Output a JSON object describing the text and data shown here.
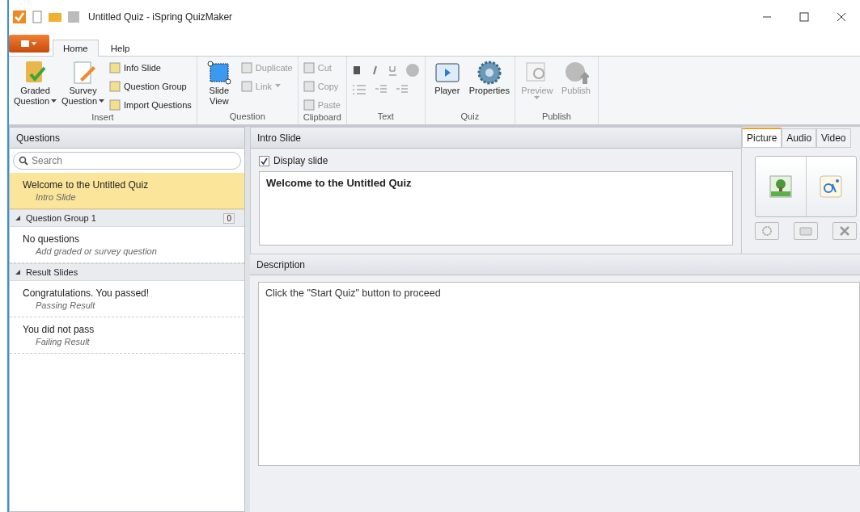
{
  "window": {
    "title": "Untitled Quiz - iSpring QuizMaker"
  },
  "ribbon": {
    "tabs": [
      {
        "label": "Home",
        "selected": true
      },
      {
        "label": "Help",
        "selected": false
      }
    ],
    "groups": [
      {
        "label": "Insert",
        "items": [
          {
            "kind": "large",
            "label": "Graded",
            "label2": "Question",
            "dropdown": true,
            "disabled": false
          },
          {
            "kind": "large",
            "label": "Survey",
            "label2": "Question",
            "dropdown": true,
            "disabled": false
          },
          {
            "kind": "small",
            "label": "Info Slide",
            "disabled": false
          },
          {
            "kind": "small",
            "label": "Question Group",
            "disabled": false
          },
          {
            "kind": "small",
            "label": "Import Questions",
            "disabled": false
          }
        ]
      },
      {
        "label": "Question",
        "items": [
          {
            "kind": "large",
            "label": "Slide",
            "label2": "View",
            "dropdown": false,
            "disabled": false
          },
          {
            "kind": "small",
            "label": "Duplicate",
            "disabled": true
          },
          {
            "kind": "small",
            "label": "Link",
            "dropdown": true,
            "disabled": true
          }
        ]
      },
      {
        "label": "Clipboard",
        "items": [
          {
            "kind": "small",
            "label": "Cut",
            "disabled": true
          },
          {
            "kind": "small",
            "label": "Copy",
            "disabled": true
          },
          {
            "kind": "small",
            "label": "Paste",
            "disabled": true
          }
        ]
      },
      {
        "label": "Text",
        "items": [
          {
            "kind": "format"
          }
        ]
      },
      {
        "label": "Quiz",
        "items": [
          {
            "kind": "large",
            "label": "Player",
            "dropdown": false,
            "disabled": false
          },
          {
            "kind": "large",
            "label": "Properties",
            "dropdown": false,
            "disabled": false
          }
        ]
      },
      {
        "label": "Publish",
        "items": [
          {
            "kind": "large",
            "label": "Preview",
            "dropdown": true,
            "disabled": true
          },
          {
            "kind": "large",
            "label": "Publish",
            "dropdown": false,
            "disabled": true
          }
        ]
      }
    ]
  },
  "questions": {
    "title": "Questions",
    "search": {
      "placeholder": "Search"
    },
    "items": [
      {
        "kind": "slide",
        "title": "Welcome to the Untitled Quiz",
        "subtitle": "Intro Slide",
        "selected": true
      },
      {
        "kind": "group",
        "title": "Question Group 1",
        "count": "0"
      },
      {
        "kind": "slide",
        "title": "No questions",
        "subtitle": "Add graded or survey question",
        "selected": false
      },
      {
        "kind": "group",
        "title": "Result Slides"
      },
      {
        "kind": "slide",
        "title": "Congratulations. You passed!",
        "subtitle": "Passing Result",
        "selected": false
      },
      {
        "kind": "slide",
        "title": "You did not pass",
        "subtitle": "Failing Result",
        "selected": false
      }
    ]
  },
  "editor": {
    "header": "Intro Slide",
    "display_slide": {
      "label": "Display slide",
      "checked": true
    },
    "slide_title": "Welcome to the Untitled Quiz",
    "description_header": "Description",
    "description": "Click the \"Start Quiz\" button to proceed"
  },
  "media": {
    "tabs": [
      {
        "label": "Picture",
        "selected": true
      },
      {
        "label": "Audio",
        "selected": false
      },
      {
        "label": "Video",
        "selected": false
      }
    ]
  }
}
